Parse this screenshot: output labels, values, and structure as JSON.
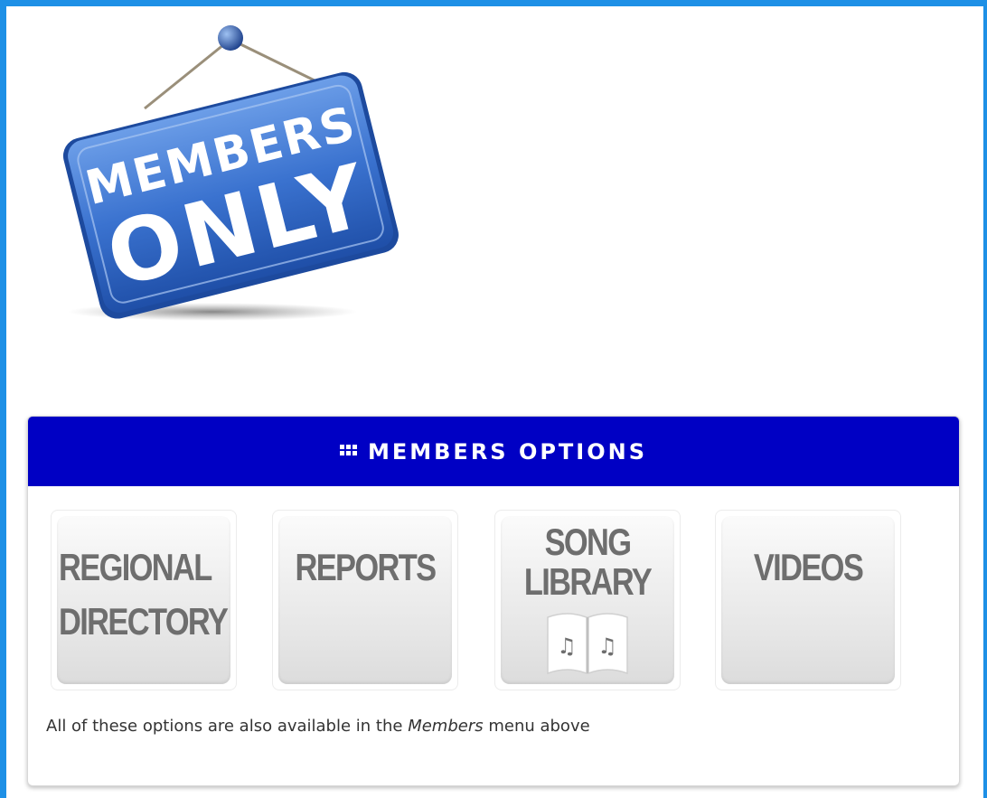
{
  "sign": {
    "line1": "MEMBERS",
    "line2": "ONLY"
  },
  "panel": {
    "icon": "grid-icon",
    "title": "MEMBERS OPTIONS",
    "tiles": [
      {
        "lines": [
          "REGIONAL",
          "DIRECTORY"
        ]
      },
      {
        "lines": [
          "REPORTS"
        ]
      },
      {
        "lines": [
          "SONG",
          "LIBRARY"
        ],
        "icon": "songbook-icon"
      },
      {
        "lines": [
          "VIDEOS"
        ]
      }
    ],
    "note": {
      "before": "All of these options are also available in the ",
      "emphasis": "Members",
      "after": " menu above"
    }
  },
  "colors": {
    "frame": "#1e90e6",
    "header": "#0000c4",
    "sign_blue": "#2f67c4",
    "tile_text": "#6e6e6e"
  }
}
